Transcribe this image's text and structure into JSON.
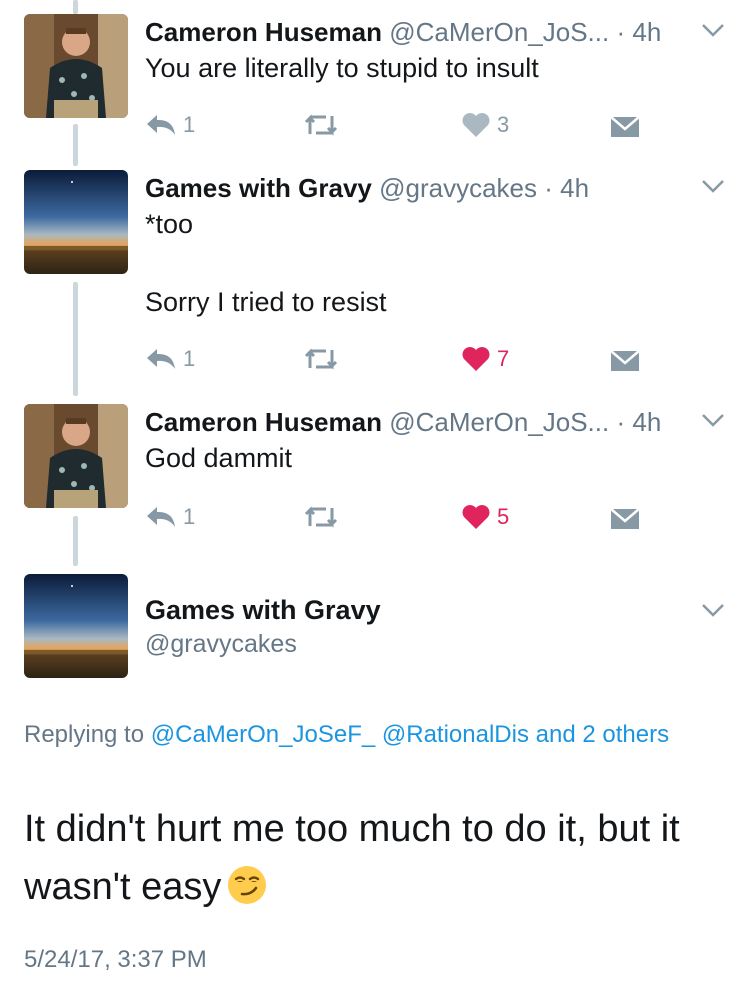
{
  "tweets": [
    {
      "name": "Cameron Huseman",
      "handle": "@CaMerOn_JoS...",
      "dot": "·",
      "time": "4h",
      "lines": [
        "You are literally to stupid to insult"
      ],
      "reply_count": "1",
      "like_count": "3",
      "liked": false
    },
    {
      "name": "Games with Gravy",
      "handle": "@gravycakes",
      "dot": "·",
      "time": "4h",
      "lines": [
        "*too",
        "Sorry I tried to resist"
      ],
      "reply_count": "1",
      "like_count": "7",
      "liked": true
    },
    {
      "name": "Cameron Huseman",
      "handle": "@CaMerOn_JoS...",
      "dot": "·",
      "time": "4h",
      "lines": [
        "God dammit"
      ],
      "reply_count": "1",
      "like_count": "5",
      "liked": true
    }
  ],
  "focus": {
    "name": "Games with Gravy",
    "handle": "@gravycakes",
    "replying_prefix": "Replying to",
    "replying_user1": "@CaMerOn_JoSeF_",
    "replying_user2": "@RationalDis",
    "replying_suffix": "and 2 others",
    "text": "It didn't hurt me too much to do it, but it wasn't easy",
    "emoji": "smirking-face-emoji",
    "timestamp": "5/24/17, 3:37 PM"
  },
  "icons": {
    "reply": "reply-icon",
    "retweet": "retweet-icon",
    "like": "heart-icon",
    "dm": "direct-message-icon",
    "caret": "chevron-down-icon"
  },
  "colors": {
    "name": "#14171a",
    "meta": "#657786",
    "action": "#8899a6",
    "like_active": "#e0245e",
    "link": "#1b95e0",
    "thread_line": "#ccd6dd"
  }
}
